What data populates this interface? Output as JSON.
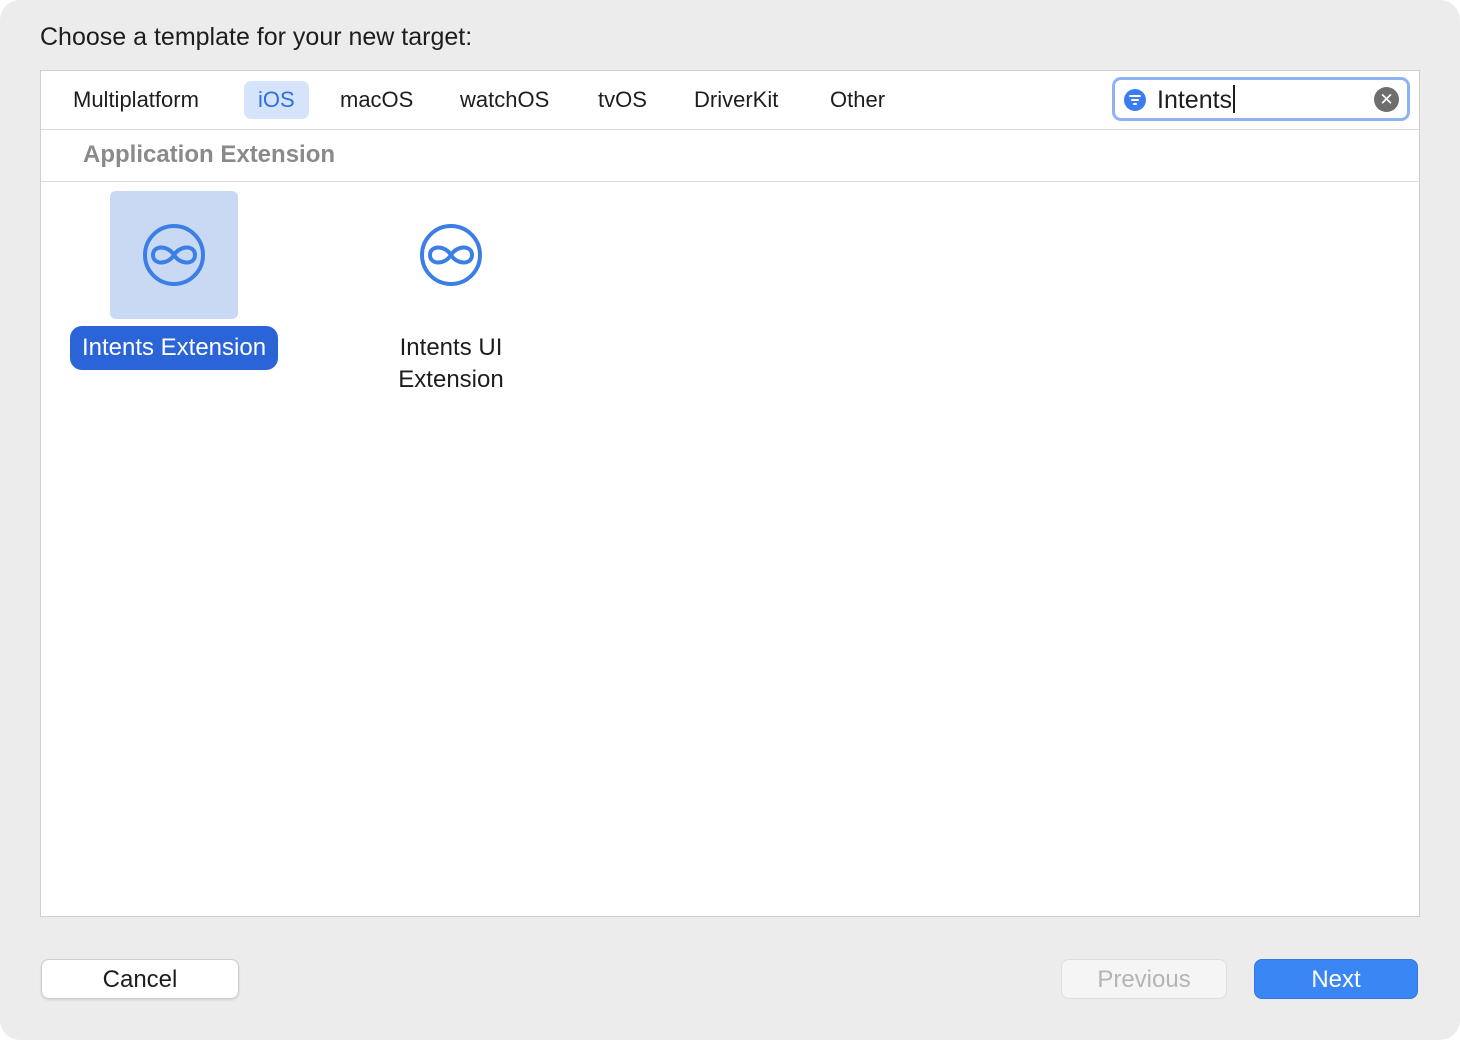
{
  "prompt": "Choose a template for your new target:",
  "tabs": [
    {
      "label": "Multiplatform",
      "selected": false
    },
    {
      "label": "iOS",
      "selected": true
    },
    {
      "label": "macOS",
      "selected": false
    },
    {
      "label": "watchOS",
      "selected": false
    },
    {
      "label": "tvOS",
      "selected": false
    },
    {
      "label": "DriverKit",
      "selected": false
    },
    {
      "label": "Other",
      "selected": false
    }
  ],
  "search": {
    "value": "Intents",
    "filter_icon": "filter-icon",
    "clear_icon": "clear-icon"
  },
  "section": {
    "title": "Application Extension"
  },
  "templates": [
    {
      "label": "Intents Extension",
      "icon": "intents-icon",
      "selected": true
    },
    {
      "label_line1": "Intents UI",
      "label_line2": "Extension",
      "icon": "intents-icon",
      "selected": false
    }
  ],
  "buttons": {
    "cancel": "Cancel",
    "previous": "Previous",
    "next": "Next"
  },
  "colors": {
    "accent": "#2a64d6",
    "icon_blue": "#3b7ee6",
    "next_button": "#3a86f5"
  }
}
